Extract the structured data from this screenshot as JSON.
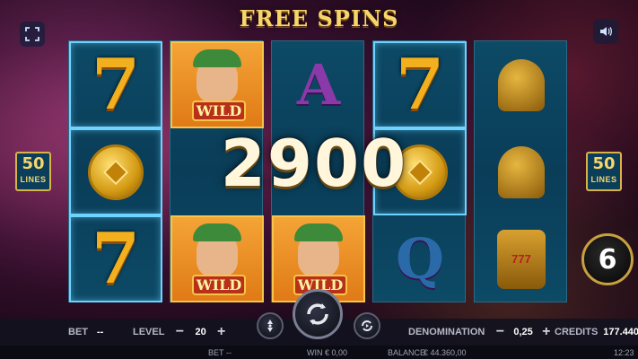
{
  "title": "FREE SPINS",
  "win_amount": "2900",
  "lines": {
    "number": "50",
    "label": "LINES"
  },
  "spins_remaining": "6",
  "reels": [
    [
      "seven",
      "coin",
      "seven"
    ],
    [
      "wild",
      "blank",
      "wild"
    ],
    [
      "A",
      "blank",
      "wild"
    ],
    [
      "seven",
      "coin",
      "Q"
    ],
    [
      "bell",
      "bell",
      "slot-machine"
    ]
  ],
  "wild_label": "WILD",
  "slot_machine_label": "777",
  "bar": {
    "bet_label": "BET",
    "bet_value": "--",
    "level_label": "LEVEL",
    "level_value": "20",
    "denomination_label": "DENOMINATION",
    "denomination_value": "0,25",
    "credits_label": "CREDITS",
    "credits_value": "177.440",
    "minus": "−",
    "plus": "+"
  },
  "footer": {
    "bet_label": "BET",
    "bet_value": "--",
    "win_label": "WIN",
    "win_value": "€ 0,00",
    "balance_label": "BALANCE",
    "balance_value": "€ 44.360,00",
    "clock": "12:23"
  },
  "icons": {
    "fullscreen": "fullscreen-icon",
    "sound": "speaker-icon",
    "autoplay": "autoplay-icon",
    "spin": "spin-icon",
    "turbo": "turbo-icon"
  },
  "colors": {
    "title_gold": "#f6d56a",
    "reel_blue": "#0a3d58",
    "highlight_frame": "#6fd3ff"
  }
}
